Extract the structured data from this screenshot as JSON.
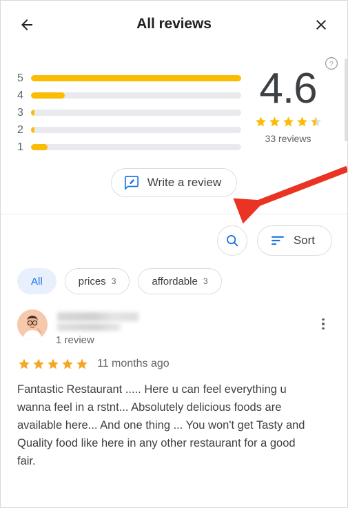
{
  "header": {
    "title": "All reviews",
    "back_icon": "arrow-left-icon",
    "close_icon": "close-icon",
    "help_icon": "help-circle-icon"
  },
  "summary": {
    "score": "4.6",
    "reviews_count": "33 reviews",
    "stars_filled": 4,
    "half_star": true,
    "histogram": [
      {
        "label": "5",
        "percent": 100
      },
      {
        "label": "4",
        "percent": 16
      },
      {
        "label": "3",
        "percent": 1.5
      },
      {
        "label": "2",
        "percent": 1.5
      },
      {
        "label": "1",
        "percent": 8
      }
    ]
  },
  "write_review": {
    "label": "Write a review",
    "icon": "rate-review-icon"
  },
  "tools": {
    "search_icon": "search-icon",
    "sort_label": "Sort",
    "sort_icon": "sort-lines-icon"
  },
  "chips": [
    {
      "label": "All",
      "count": "",
      "selected": true
    },
    {
      "label": "prices",
      "count": "3",
      "selected": false
    },
    {
      "label": "affordable",
      "count": "3",
      "selected": false
    }
  ],
  "review": {
    "reviewer_name_hidden": true,
    "review_count": "1 review",
    "stars": 5,
    "time": "11 months ago",
    "text": "Fantastic Restaurant ..... Here u can feel everything u wanna feel in a rstnt... Absolutely delicious foods are available here... And one thing ...  You won't get Tasty and Quality food like here in any other restaurant for a good fair.",
    "menu_icon": "more-vertical-icon"
  },
  "annotation": {
    "arrow_color": "#ea3323"
  },
  "colors": {
    "star": "#fbbc04",
    "review_star": "#f5a623",
    "accent_blue": "#1a73e8",
    "chip_selected_bg": "#e8f0fe",
    "track": "#e8eaed"
  }
}
